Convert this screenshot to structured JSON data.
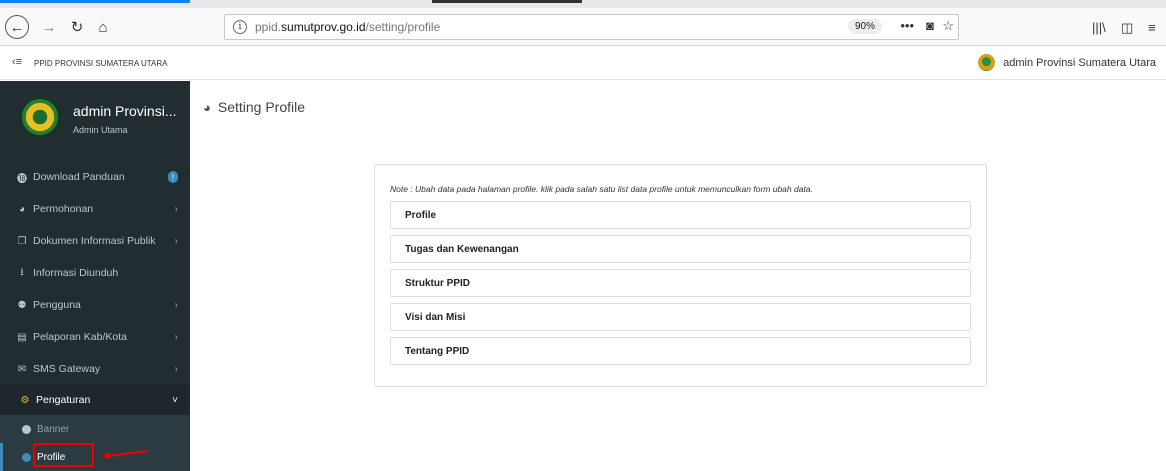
{
  "browser": {
    "url_prefix": "ppid.",
    "url_domain": "sumutprov.go.id",
    "url_path": "/setting/profile",
    "zoom": "90%",
    "info_icon": "i"
  },
  "header": {
    "hamburger": "‹≡",
    "site_name": "PPID PROVINSI SUMATERA UTARA",
    "user_name": "admin Provinsi Sumatera Utara"
  },
  "sidebar": {
    "user_name": "admin Provinsi...",
    "user_role": "Admin Utama",
    "items": [
      {
        "label": "Download Panduan",
        "icon": "⓲",
        "icon_name": "info-icon",
        "badge": "!"
      },
      {
        "label": "Permohonan",
        "icon": "◕",
        "icon_name": "comments-icon",
        "chevron": "›"
      },
      {
        "label": "Dokumen Informasi Publik",
        "icon": "❐",
        "icon_name": "copy-icon",
        "chevron": "›"
      },
      {
        "label": "Informasi Diunduh",
        "icon": "⭳",
        "icon_name": "download-icon"
      },
      {
        "label": "Pengguna",
        "icon": "⚉",
        "icon_name": "users-icon",
        "chevron": "›"
      },
      {
        "label": "Pelaporan Kab/Kota",
        "icon": "▤",
        "icon_name": "file-icon",
        "chevron": "›"
      },
      {
        "label": "SMS Gateway",
        "icon": "✉",
        "icon_name": "envelope-icon",
        "chevron": "›"
      },
      {
        "label": "Pengaturan",
        "icon": "⚙",
        "icon_name": "gear-icon",
        "chevron": "˅"
      }
    ],
    "sub_items": [
      {
        "label": "Banner"
      },
      {
        "label": "Profile"
      }
    ]
  },
  "page": {
    "title": "Setting Profile",
    "note": "Note : Ubah data pada halaman profile. klik pada salah satu list data profile untuk memunculkan form ubah data.",
    "profile_items": [
      "Profile",
      "Tugas dan Kewenangan",
      "Struktur PPID",
      "Visi dan Misi",
      "Tentang PPID"
    ]
  },
  "colors": {
    "sidebar_bg": "#222d32",
    "accent": "#3c8dbc",
    "highlight": "#e00000"
  }
}
